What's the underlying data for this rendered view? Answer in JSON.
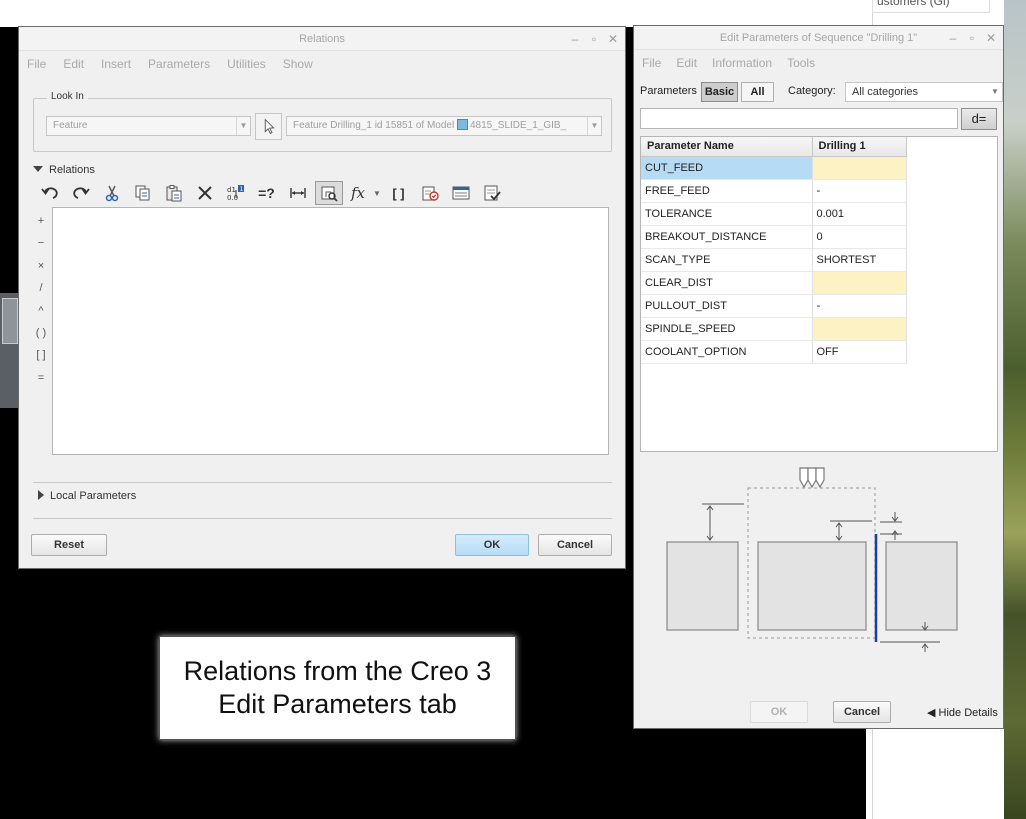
{
  "background": {
    "top_right_text": "ustomers (Gl)"
  },
  "relations_dialog": {
    "title": "Relations",
    "menu": [
      "File",
      "Edit",
      "Insert",
      "Parameters",
      "Utilities",
      "Show"
    ],
    "look_in": {
      "label": "Look In",
      "type_value": "Feature",
      "model_value_prefix": "Feature Drilling_1 id 15851 of Model ",
      "model_name": "4815_SLIDE_1_GIB_"
    },
    "relations_label": "Relations",
    "toolbar_icons": [
      "undo-icon",
      "redo-icon",
      "cut-icon",
      "copy-icon",
      "paste-icon",
      "delete-icon",
      "sort-relations-icon",
      "evaluate-icon",
      "dimension-icon",
      "show-dimension-icon",
      "function-icon",
      "brackets-icon",
      "verify-icon",
      "insert-parameter-icon",
      "execute-icon"
    ],
    "function_label": "fx",
    "eval_label": "=?",
    "brackets_label": "[ ]",
    "operators": [
      "+",
      "−",
      "×",
      "/",
      "^",
      "( )",
      "[ ]",
      "="
    ],
    "local_parameters_label": "Local Parameters",
    "buttons": {
      "reset": "Reset",
      "ok": "OK",
      "cancel": "Cancel"
    }
  },
  "edit_params_dialog": {
    "title": "Edit Parameters of Sequence \"Drilling 1\"",
    "menu": [
      "File",
      "Edit",
      "Information",
      "Tools"
    ],
    "parameters_label": "Parameters",
    "basic_label": "Basic",
    "all_label": "All",
    "category_label": "Category:",
    "category_value": "All categories",
    "deq_label": "d=",
    "table": {
      "headers": [
        "Parameter Name",
        "Drilling 1"
      ],
      "rows": [
        {
          "name": "CUT_FEED",
          "value": "",
          "required": true,
          "selected": true
        },
        {
          "name": "FREE_FEED",
          "value": "-",
          "required": false,
          "selected": false
        },
        {
          "name": "TOLERANCE",
          "value": "0.001",
          "required": false,
          "selected": false
        },
        {
          "name": "BREAKOUT_DISTANCE",
          "value": "0",
          "required": false,
          "selected": false
        },
        {
          "name": "SCAN_TYPE",
          "value": "SHORTEST",
          "required": false,
          "selected": false
        },
        {
          "name": "CLEAR_DIST",
          "value": "",
          "required": true,
          "selected": false
        },
        {
          "name": "PULLOUT_DIST",
          "value": "-",
          "required": false,
          "selected": false
        },
        {
          "name": "SPINDLE_SPEED",
          "value": "",
          "required": true,
          "selected": false
        },
        {
          "name": "COOLANT_OPTION",
          "value": "OFF",
          "required": false,
          "selected": false
        }
      ]
    },
    "buttons": {
      "ok": "OK",
      "cancel": "Cancel",
      "hide_details": "Hide Details"
    }
  },
  "caption": {
    "line1": "Relations from the Creo 3",
    "line2": "Edit Parameters tab"
  },
  "colors": {
    "required_cell": "#fdf2c4",
    "selected_row": "#b5dbf5",
    "ok_button": "#b5dcf6",
    "diagram_drill": "#1a3da8"
  }
}
